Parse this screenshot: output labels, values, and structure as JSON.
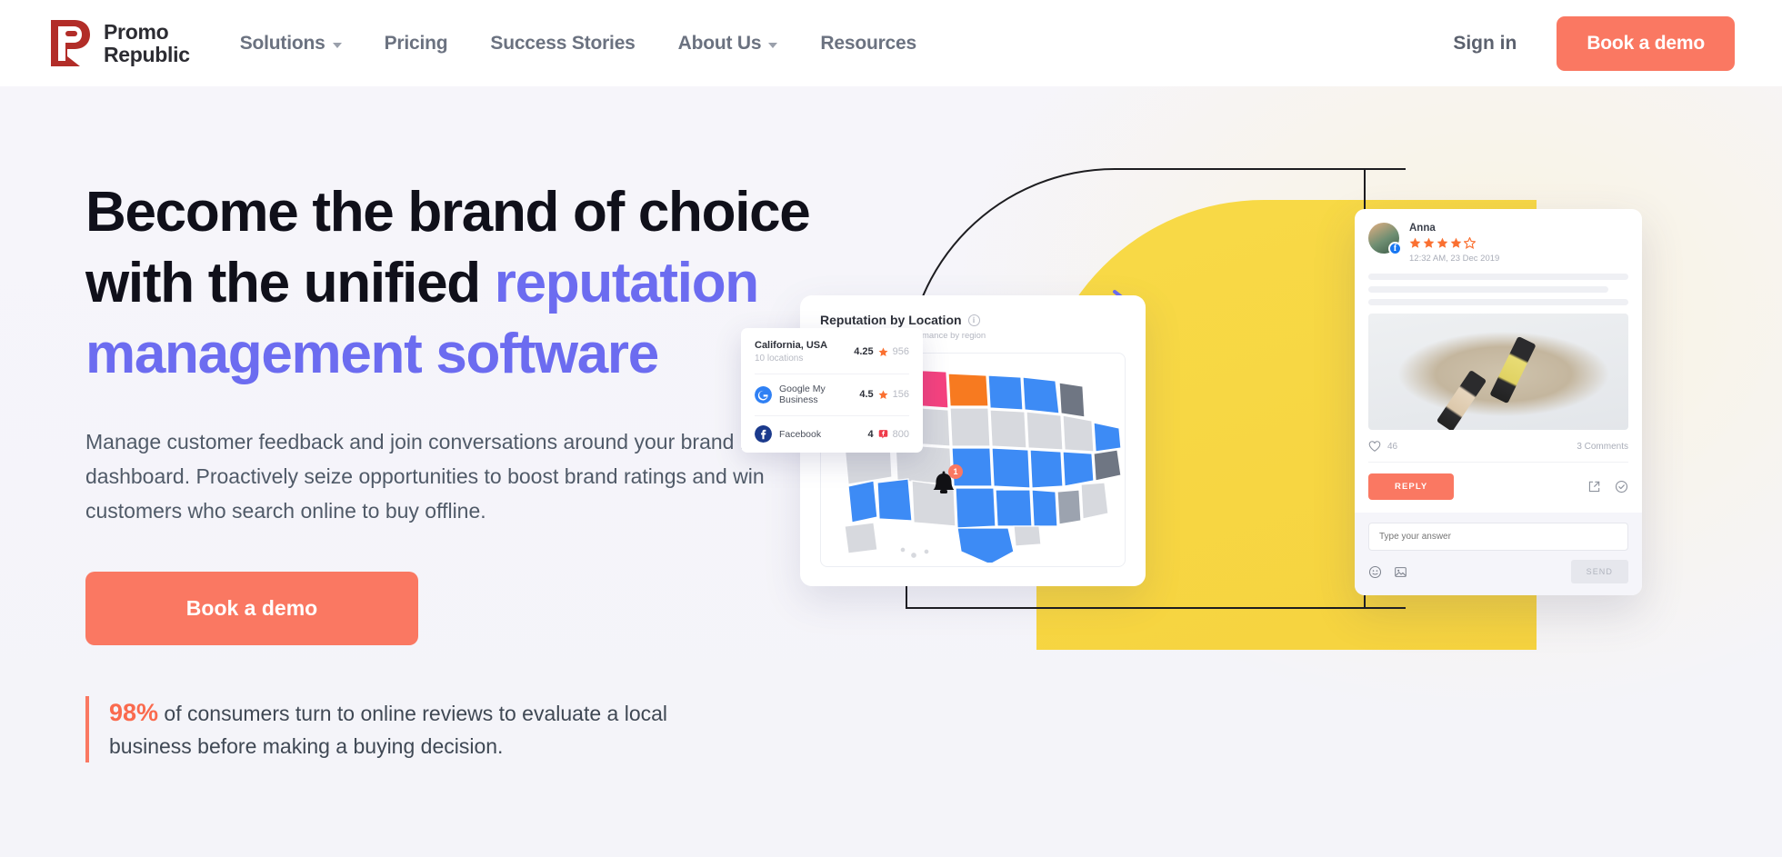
{
  "header": {
    "logo": {
      "line1": "Promo",
      "line2": "Republic",
      "icon": "promorepublic-logo-icon"
    },
    "nav": [
      {
        "label": "Solutions",
        "has_dropdown": true
      },
      {
        "label": "Pricing",
        "has_dropdown": false
      },
      {
        "label": "Success Stories",
        "has_dropdown": false
      },
      {
        "label": "About Us",
        "has_dropdown": true
      },
      {
        "label": "Resources",
        "has_dropdown": false
      }
    ],
    "sign_in": "Sign in",
    "book_demo": "Book a demo"
  },
  "hero": {
    "headline_part1": "Become the brand of choice",
    "headline_part2": "with the unified ",
    "headline_accent1": "reputation",
    "headline_accent2": "management software",
    "subcopy": "Manage customer feedback and join conversations around your brand in one dashboard. Proactively seize opportunities to boost brand ratings and win customers who search online to buy offline.",
    "cta": "Book a demo",
    "stat_percent": "98%",
    "stat_text": " of consumers turn to online reviews to evaluate a local business before making a buying decision."
  },
  "map_card": {
    "title": "Reputation by Location",
    "info_icon": "info-icon",
    "subtitle": "Aggregated location performance by region",
    "bell_icon": "notification-bell-icon",
    "bell_badge": "1"
  },
  "location_tooltip": {
    "name": "California, USA",
    "locations": "10 locations",
    "score": "4.25",
    "star_icon": "star-icon",
    "count": "956",
    "platforms": [
      {
        "icon": "google-my-business-icon",
        "name": "Google My Business",
        "score": "4.5",
        "rating_icon": "star-icon",
        "count": "156"
      },
      {
        "icon": "facebook-icon",
        "name": "Facebook",
        "score": "4",
        "rating_icon": "facebook-rating-icon",
        "count": "800"
      }
    ]
  },
  "review_card": {
    "author": "Anna",
    "avatar": "user-avatar",
    "source_badge": "facebook-icon",
    "rating_filled": 4,
    "rating_total": 5,
    "date": "12:32 AM, 23 Dec 2019",
    "image_alt": "cosmetic-bottles-photo",
    "like_icon": "heart-icon",
    "likes": "46",
    "comments": "3 Comments",
    "reply_button": "REPLY",
    "share_icon": "external-link-icon",
    "approve_icon": "check-circle-icon",
    "answer_placeholder": "Type your answer",
    "emoji_icon": "emoji-icon",
    "image_icon": "image-icon",
    "send_button": "SEND"
  },
  "colors": {
    "brand_red": "#b22d28",
    "coral": "#fa7862",
    "purple": "#6c6cf0",
    "yellow": "#f7d73f",
    "map_blue": "#3d8bf5",
    "map_pink": "#f5427f",
    "map_orange": "#f77a20"
  }
}
